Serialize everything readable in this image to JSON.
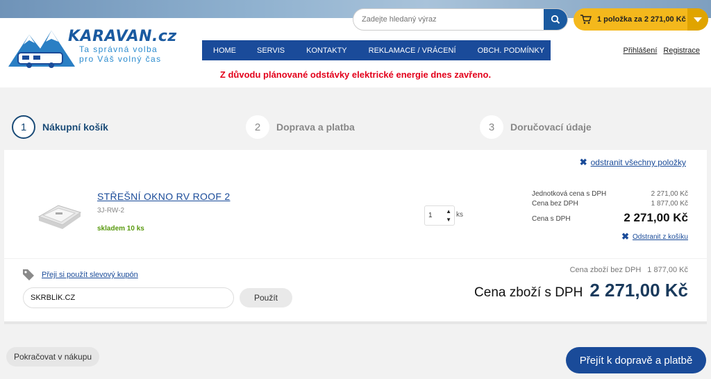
{
  "brand": {
    "name": "KARAVAN.cz",
    "slogan_line1": "Ta správná volba",
    "slogan_line2": "pro Váš volný čas"
  },
  "search": {
    "placeholder": "Zadejte hledaný výraz"
  },
  "cart_summary": {
    "prefix": "1 položka za",
    "amount": "2 271,00 Kč"
  },
  "nav": {
    "items": [
      "HOME",
      "SERVIS",
      "KONTAKTY",
      "REKLAMACE / VRÁCENÍ",
      "OBCH. PODMÍNKY"
    ]
  },
  "auth": {
    "login": "Přihlášení",
    "register": "Registrace"
  },
  "notice": "Z důvodu plánované odstávky elektrické energie dnes zavřeno.",
  "steps": [
    {
      "number": "1",
      "label": "Nákupní košík"
    },
    {
      "number": "2",
      "label": "Doprava a platba"
    },
    {
      "number": "3",
      "label": "Doručovací údaje"
    }
  ],
  "cart": {
    "remove_all": "odstranit všechny položky",
    "item": {
      "name": "STŘEŠNÍ OKNO RV ROOF 2",
      "code": "3J-RW-2",
      "stock": "skladem 10 ks",
      "quantity": "1",
      "unit": "ks",
      "unit_price_label": "Jednotková cena s DPH",
      "unit_price": "2 271,00 Kč",
      "price_no_vat_label": "Cena bez DPH",
      "price_no_vat": "1 877,00 Kč",
      "price_vat_label": "Cena s DPH",
      "price_vat": "2 271,00 Kč",
      "remove": "Odstranit z košíku"
    }
  },
  "coupon": {
    "link": "Přeji si použít slevový kupón",
    "value": "SKRBLÍK.CZ",
    "apply": "Použít"
  },
  "totals": {
    "no_vat_label": "Cena zboží bez DPH",
    "no_vat": "1 877,00 Kč",
    "vat_label": "Cena zboží s DPH",
    "vat": "2 271,00 Kč"
  },
  "actions": {
    "continue": "Pokračovat v nákupu",
    "checkout": "Přejít k dopravě a platbě"
  },
  "colors": {
    "brand_blue": "#1a4b99",
    "cart_yellow": "#f4b81c",
    "notice_red": "#e3001b",
    "stock_green": "#5a9a10"
  }
}
